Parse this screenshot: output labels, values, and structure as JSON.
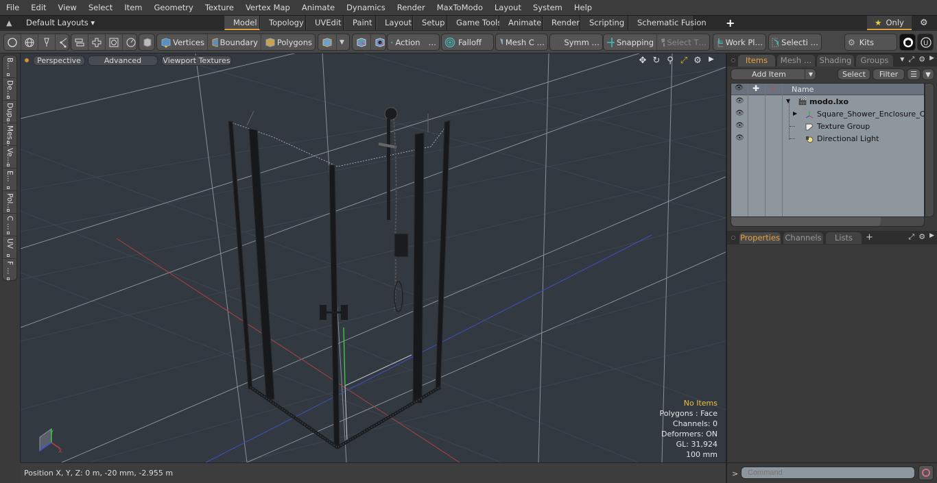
{
  "menu": [
    "File",
    "Edit",
    "View",
    "Select",
    "Item",
    "Geometry",
    "Texture",
    "Vertex Map",
    "Animate",
    "Dynamics",
    "Render",
    "MaxToModo",
    "Layout",
    "System",
    "Help"
  ],
  "layout_bar": {
    "layouts_label": "Default Layouts ▾",
    "tabs": [
      "Model",
      "Topology",
      "UVEdit",
      "Paint",
      "Layout",
      "Setup",
      "Game Tools",
      "Animate",
      "Render",
      "Scripting",
      "Schematic Fusion"
    ],
    "active_tab": "Model",
    "add_tab": "+",
    "only_label": "Only",
    "star": "★"
  },
  "toolbar": {
    "vertices": "Vertices",
    "boundary": "Boundary",
    "polygons": "Polygons",
    "action": "Action",
    "falloff": "Falloff",
    "mesh_c": "Mesh C …",
    "symm": "Symm …",
    "snapping": "Snapping",
    "select_t": "Select T…",
    "work_pl": "Work Pl…",
    "selecti": "Selecti …",
    "kits": "Kits",
    "ellipsis": "…"
  },
  "left_tabs": [
    "B...",
    "De...",
    "Dup...",
    "Mes...",
    "Ve...",
    "E...",
    "Pol...",
    "C ...",
    "UV",
    "F ..."
  ],
  "viewport": {
    "perspective": "Perspective",
    "advanced": "Advanced",
    "viewport_textures": "Viewport Textures",
    "info": {
      "selection": "No Items",
      "polygons": "Polygons : Face",
      "channels": "Channels: 0",
      "deformers": "Deformers: ON",
      "gl": "GL: 31,924",
      "grid": "100 mm"
    },
    "axis_labels": {
      "x": "X",
      "y": "Y",
      "z": "Z"
    },
    "colors": {
      "x_axis": "#c04040",
      "z_axis": "#4050c0",
      "y_axis": "#40c040",
      "highlight": "#f0c040"
    }
  },
  "status": {
    "position": "Position X, Y, Z:   0 m, -20 mm, -2.955 m"
  },
  "items_panel": {
    "tabs": [
      "Items",
      "Mesh …",
      "Shading",
      "Groups"
    ],
    "active_tab": "Items",
    "add_item": "Add Item",
    "select": "Select",
    "filter": "Filter",
    "column_name": "Name",
    "rows": [
      {
        "name": "modo.lxo",
        "type": "scene"
      },
      {
        "name": "Square_Shower_Enclosure_C…",
        "type": "mesh"
      },
      {
        "name": "Texture Group",
        "type": "texture-group"
      },
      {
        "name": "Directional Light",
        "type": "light"
      }
    ]
  },
  "properties_panel": {
    "tabs": [
      "Properties",
      "Channels",
      "Lists"
    ],
    "active_tab": "Properties",
    "add": "+"
  },
  "command": {
    "prompt": ">",
    "placeholder": "Command"
  }
}
